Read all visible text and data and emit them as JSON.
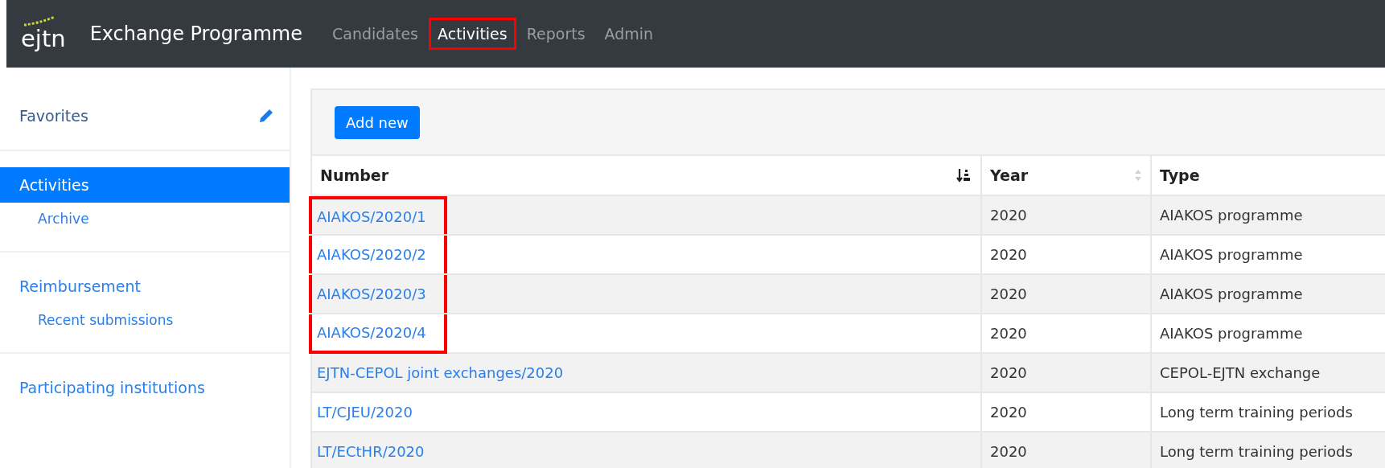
{
  "header": {
    "logo": "ejtn",
    "title": "Exchange Programme",
    "nav": [
      {
        "label": "Candidates",
        "selected": false,
        "highlighted": false
      },
      {
        "label": "Activities",
        "selected": true,
        "highlighted": true
      },
      {
        "label": "Reports",
        "selected": false,
        "highlighted": false
      },
      {
        "label": "Admin",
        "selected": false,
        "highlighted": false
      }
    ]
  },
  "sidebar": {
    "sections": [
      {
        "items": [
          {
            "label": "Favorites",
            "selected": false,
            "kind": "heading",
            "editable": true
          }
        ]
      },
      {
        "items": [
          {
            "label": "Activities",
            "selected": true,
            "kind": "heading",
            "editable": false
          },
          {
            "label": "Archive",
            "selected": false,
            "kind": "sub",
            "editable": false
          }
        ]
      },
      {
        "items": [
          {
            "label": "Reimbursement",
            "selected": false,
            "kind": "heading",
            "editable": false
          },
          {
            "label": "Recent submissions",
            "selected": false,
            "kind": "sub",
            "editable": false
          }
        ]
      },
      {
        "items": [
          {
            "label": "Participating institutions",
            "selected": false,
            "kind": "heading",
            "editable": false
          }
        ]
      }
    ]
  },
  "toolbar": {
    "add_button": "Add new"
  },
  "table": {
    "columns": [
      {
        "label": "Number",
        "sortable": true,
        "sorted_descending": true
      },
      {
        "label": "Year",
        "sortable": true,
        "sorted_descending": false
      },
      {
        "label": "Type"
      }
    ],
    "rows": [
      {
        "number": "AIAKOS/2020/1",
        "year": "2020",
        "type": "AIAKOS programme",
        "highlighted": true
      },
      {
        "number": "AIAKOS/2020/2",
        "year": "2020",
        "type": "AIAKOS programme",
        "highlighted": true
      },
      {
        "number": "AIAKOS/2020/3",
        "year": "2020",
        "type": "AIAKOS programme",
        "highlighted": true
      },
      {
        "number": "AIAKOS/2020/4",
        "year": "2020",
        "type": "AIAKOS programme",
        "highlighted": true
      },
      {
        "number": "EJTN-CEPOL joint exchanges/2020",
        "year": "2020",
        "type": "CEPOL-EJTN exchange",
        "highlighted": false
      },
      {
        "number": "LT/CJEU/2020",
        "year": "2020",
        "type": "Long term training periods",
        "highlighted": false
      },
      {
        "number": "LT/ECtHR/2020",
        "year": "2020",
        "type": "Long term training periods",
        "highlighted": false
      }
    ]
  }
}
